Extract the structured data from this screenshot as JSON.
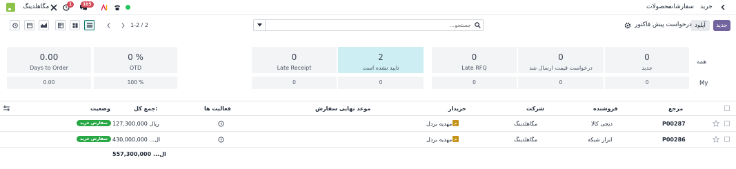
{
  "nav": {
    "app_title": "خرید",
    "menu": [
      "سفارشات",
      "محصولات"
    ],
    "company": "مگاهلدینگ",
    "msg_count": "105",
    "activity_count": "1"
  },
  "controls": {
    "new_label": "جدید",
    "upload_label": "آپلود",
    "view_title": "درخواست پیش فاکتور",
    "search_placeholder": "جستجو...",
    "pager": "1-2 / 2"
  },
  "dashboard": {
    "row_all_label": "همه",
    "row_my_label": "My",
    "cards": [
      {
        "value": "0",
        "label": "جدید",
        "my": "0"
      },
      {
        "value": "0",
        "label": "درخواست قیمت ارسال شد",
        "my": "0"
      },
      {
        "value": "0",
        "label": "Late RFQ",
        "my": "0"
      },
      {
        "value": "2",
        "label": "تایید نشده است",
        "my": "0"
      },
      {
        "value": "0",
        "label": "Late Receipt",
        "my": "0"
      }
    ],
    "kpis": [
      {
        "value": "0 %",
        "label": "OTD",
        "my": "100 %"
      },
      {
        "value": "0.00",
        "label": "Days to Order",
        "my": "0.00"
      }
    ]
  },
  "table": {
    "headers": {
      "ref": "مرجع",
      "vendor": "فروشنده",
      "company": "شرکت",
      "buyer": "خریدار",
      "deadline": "موعد نهایی سفارش",
      "activities": "فعالیت ها",
      "total": "جمع کل:",
      "status": "وضعیت"
    },
    "rows": [
      {
        "ref": "P00287",
        "vendor": "دیجی کالا",
        "company": "مگاهلدینگ",
        "buyer": "مهدیه بردل",
        "buyer_initial": "م",
        "total": "127,300,000 ریال",
        "status": "سفارش خرید"
      },
      {
        "ref": "P00286",
        "vendor": "ابزار شبکه",
        "company": "مگاهلدینگ",
        "buyer": "مهدیه بردل",
        "buyer_initial": "م",
        "total": "430,000,000 ...ال",
        "status": "سفارش خرید"
      }
    ],
    "grand_total": "557,300,000 ...ال"
  },
  "colors": {
    "primary": "#71639e",
    "status_green": "#28a745",
    "highlight": "#cdeff4",
    "badge_red": "#d44c59"
  },
  "icons": [
    "chevron-left-icon",
    "status-dot-icon",
    "phone-icon",
    "ai-icon",
    "chat-icon",
    "clock-icon",
    "tools-icon",
    "gear-icon",
    "search-icon",
    "caret-down-icon",
    "star-icon",
    "settings-adjust-icon"
  ]
}
